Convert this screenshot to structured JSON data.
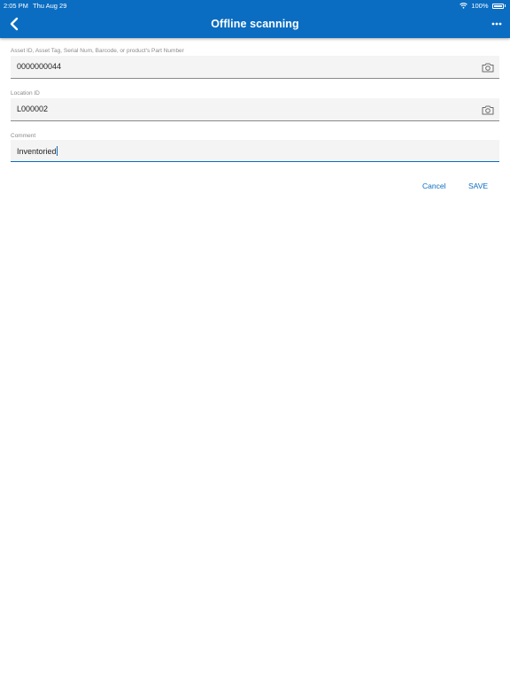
{
  "status_bar": {
    "time": "2:05 PM",
    "date": "Thu Aug 29",
    "battery": "100%"
  },
  "header": {
    "title": "Offline scanning",
    "back_icon": "chevron-left-icon",
    "more_icon": "ellipsis-icon"
  },
  "form": {
    "asset": {
      "label": "Asset ID, Asset Tag, Serial Num, Barcode, or product's Part Number",
      "value": "0000000044",
      "icon": "camera-icon"
    },
    "location": {
      "label": "Location ID",
      "value": "L000002",
      "icon": "camera-icon"
    },
    "comment": {
      "label": "Comment",
      "value": "Inventoried"
    }
  },
  "actions": {
    "cancel": "Cancel",
    "save": "SAVE"
  },
  "colors": {
    "primary": "#0a6dc1",
    "field_bg": "#f4f4f4",
    "label": "#8a8a8a"
  }
}
